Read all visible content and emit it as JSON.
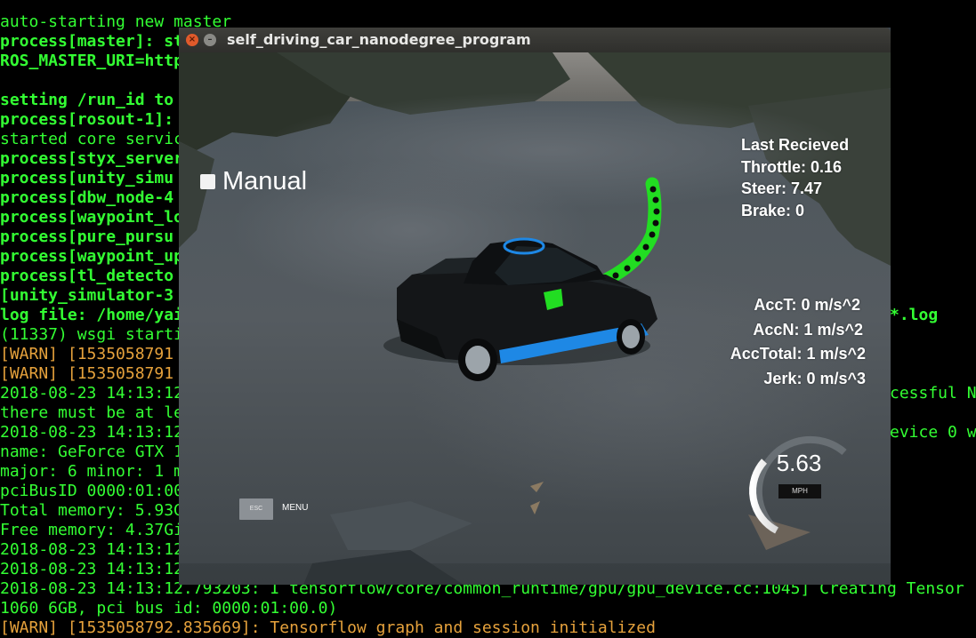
{
  "terminal": {
    "lines": [
      {
        "text": "auto-starting new master",
        "style": "n"
      },
      {
        "text": "process[master]: st",
        "style": "b"
      },
      {
        "text": "ROS_MASTER_URI=http",
        "style": "b"
      },
      {
        "text": "",
        "style": "n"
      },
      {
        "text": "setting /run_id to",
        "style": "b"
      },
      {
        "text": "process[rosout-1]:",
        "style": "b"
      },
      {
        "text": "started core servic",
        "style": "n"
      },
      {
        "text": "process[styx_server",
        "style": "b"
      },
      {
        "text": "process[unity_simu",
        "style": "b"
      },
      {
        "text": "process[dbw_node-4",
        "style": "b"
      },
      {
        "text": "process[waypoint_lo",
        "style": "b"
      },
      {
        "text": "process[pure_pursu",
        "style": "b"
      },
      {
        "text": "process[waypoint_up",
        "style": "b"
      },
      {
        "text": "process[tl_detecto",
        "style": "b"
      },
      {
        "text": "[unity_simulator-3",
        "style": "b"
      },
      {
        "text": "log file: /home/yai",
        "style": "b"
      },
      {
        "text": "(11337) wsgi starti",
        "style": "n"
      },
      {
        "text": "[WARN] [1535058791",
        "style": "warn"
      },
      {
        "text": "[WARN] [1535058791",
        "style": "warn"
      },
      {
        "text": "2018-08-23 14:13:12",
        "style": "n"
      },
      {
        "text": "there must be at le",
        "style": "n"
      },
      {
        "text": "2018-08-23 14:13:12",
        "style": "n"
      },
      {
        "text": "name: GeForce GTX 1",
        "style": "n"
      },
      {
        "text": "major: 6 minor: 1 m",
        "style": "n"
      },
      {
        "text": "pciBusID 0000:01:00",
        "style": "n"
      },
      {
        "text": "Total memory: 5.93G",
        "style": "n"
      },
      {
        "text": "Free memory: 4.37Gi",
        "style": "n"
      },
      {
        "text": "2018-08-23 14:13:12",
        "style": "n"
      },
      {
        "text": "2018-08-23 14:13:12",
        "style": "n"
      },
      {
        "text": "2018-08-23 14:13:12.793203: I tensorflow/core/common_runtime/gpu/gpu_device.cc:1045] Creating Tensor",
        "style": "n"
      },
      {
        "text": "1060 6GB, pci bus id: 0000:01:00.0)",
        "style": "n"
      },
      {
        "text": "[WARN] [1535058792.835669]: Tensorflow graph and session initialized",
        "style": "warn"
      }
    ],
    "right_fragments": [
      {
        "text": "*.log",
        "line": 15,
        "style": "b"
      },
      {
        "text": "cessful N",
        "line": 19,
        "style": "n"
      },
      {
        "text": "evice 0 w",
        "line": 21,
        "style": "n"
      }
    ]
  },
  "window": {
    "title": "self_driving_car_nanodegree_program",
    "close_icon": "×",
    "minimize_icon": "–"
  },
  "hud": {
    "manual_label": "Manual",
    "manual_checked": false,
    "last_received": {
      "heading": "Last Recieved",
      "throttle": "Throttle: 0.16",
      "steer": "Steer: 7.47",
      "brake": "Brake: 0"
    },
    "metrics": {
      "acct": "AccT: 0 m/s^2",
      "accn": "AccN: 1 m/s^2",
      "acctotal": "AccTotal: 1 m/s^2",
      "jerk": "Jerk: 0 m/s^3"
    },
    "speedometer": {
      "value": "5.63",
      "unit": "MPH"
    },
    "esc_label": "ESC",
    "menu_label": "MENU"
  },
  "colors": {
    "terminal_green": "#33ff33",
    "terminal_warn": "#e6a23c",
    "waypoint_green": "#22dd22",
    "car_body": "#141618",
    "car_stripe": "#1e88e5"
  }
}
